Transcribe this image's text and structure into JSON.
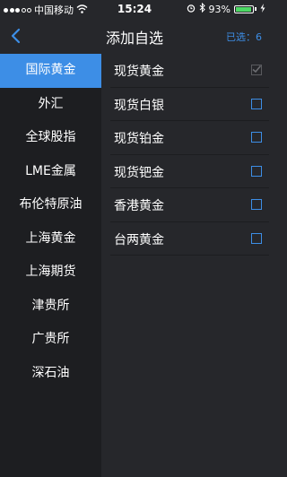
{
  "status_bar": {
    "carrier": "中国移动",
    "time": "15:24",
    "battery_percent": "93%",
    "battery_level": 0.93
  },
  "header": {
    "title": "添加自选",
    "selected_count": "已选：6"
  },
  "sidebar": {
    "items": [
      {
        "label": "国际黄金",
        "active": true
      },
      {
        "label": "外汇"
      },
      {
        "label": "全球股指"
      },
      {
        "label": "LME金属"
      },
      {
        "label": "布伦特原油"
      },
      {
        "label": "上海黄金"
      },
      {
        "label": "上海期货"
      },
      {
        "label": "津贵所"
      },
      {
        "label": "广贵所"
      },
      {
        "label": "深石油"
      }
    ]
  },
  "list": {
    "items": [
      {
        "label": "现货黄金",
        "checked": true
      },
      {
        "label": "现货白银",
        "checked": false
      },
      {
        "label": "现货铂金",
        "checked": false
      },
      {
        "label": "现货钯金",
        "checked": false
      },
      {
        "label": "香港黄金",
        "checked": false
      },
      {
        "label": "台两黄金",
        "checked": false
      }
    ]
  },
  "colors": {
    "accent": "#3d8ee6",
    "background": "#26272b",
    "sidebar_background": "#1d1e21"
  }
}
